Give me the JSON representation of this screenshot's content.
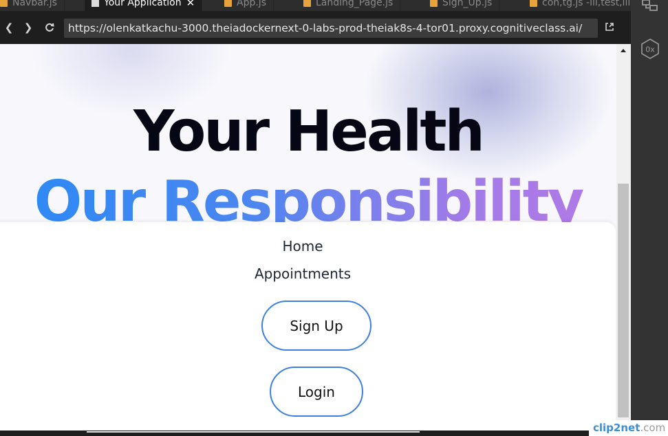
{
  "tabs": [
    {
      "label": "Navbar.js",
      "icon": "js-file-icon",
      "active": false
    },
    {
      "label": "Your Application",
      "icon": "document-icon",
      "active": true
    },
    {
      "label": "App.js",
      "icon": "js-file-icon",
      "active": false
    },
    {
      "label": "Landing_Page.js",
      "icon": "js-file-icon",
      "active": false
    },
    {
      "label": "Sign_Up.js",
      "icon": "js-file-icon",
      "active": false
    },
    {
      "label": "con,tg.js -ill,test,lil",
      "icon": "js-file-icon",
      "active": false
    }
  ],
  "browser": {
    "url": "https://olenkatkachu-3000.theiadockernext-0-labs-prod-theiak8s-4-tor01.proxy.cognitiveclass.ai/"
  },
  "hero": {
    "headline": "Your Health",
    "tagline": "Our Responsibility"
  },
  "menu": {
    "home": "Home",
    "appointments": "Appointments",
    "signup": "Sign Up",
    "login": "Login"
  },
  "right_panel": {
    "badge": "0x"
  },
  "watermark": {
    "part_a": "clip2net",
    "part_b": ".com"
  },
  "colors": {
    "accent_blue": "#2a8af5",
    "accent_purple": "#b37ae6",
    "button_border": "#3c7fe0"
  }
}
